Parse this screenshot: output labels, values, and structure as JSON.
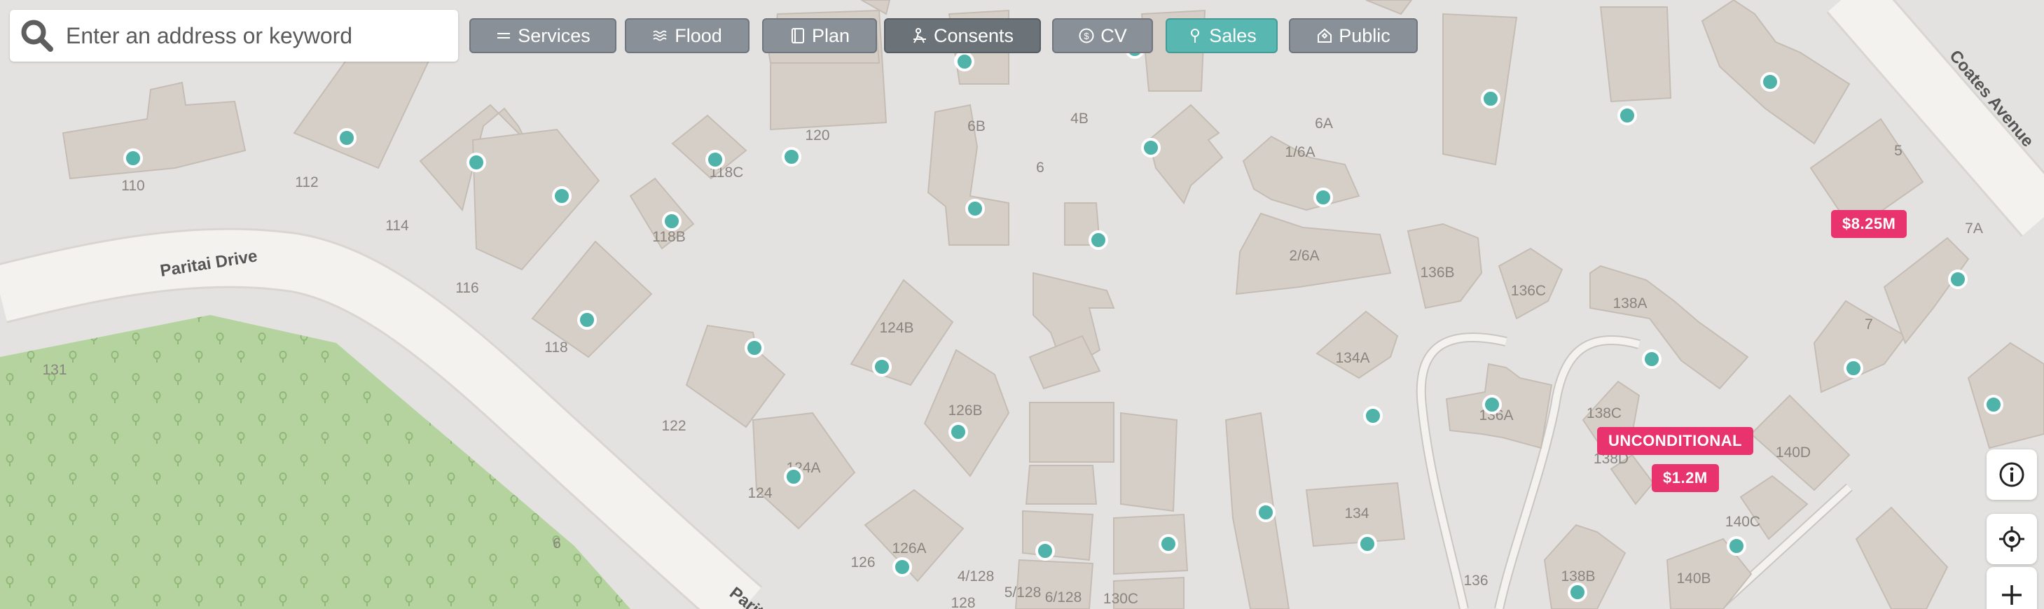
{
  "search": {
    "placeholder": "Enter an address or keyword"
  },
  "layers": [
    {
      "key": "services",
      "label": "Services",
      "icon": "lines-icon",
      "state": "inactive"
    },
    {
      "key": "flood",
      "label": "Flood",
      "icon": "waves-icon",
      "state": "inactive"
    },
    {
      "key": "plan",
      "label": "Plan",
      "icon": "book-icon",
      "state": "inactive"
    },
    {
      "key": "consents",
      "label": "Consents",
      "icon": "worker-icon",
      "state": "active-dark"
    },
    {
      "key": "cv",
      "label": "CV",
      "icon": "coin-icon",
      "state": "inactive"
    },
    {
      "key": "sales",
      "label": "Sales",
      "icon": "pin-icon",
      "state": "active-teal"
    },
    {
      "key": "public",
      "label": "Public",
      "icon": "house-icon",
      "state": "inactive"
    }
  ],
  "streets": [
    "Paritai Drive",
    "Paritai",
    "Coates Avenue"
  ],
  "address_labels": [
    "110",
    "112",
    "114",
    "116",
    "118",
    "120",
    "122",
    "124",
    "124A",
    "126",
    "126A",
    "4/128",
    "5/128",
    "6/128",
    "128",
    "130C",
    "118B",
    "118C",
    "124B",
    "126B",
    "6B",
    "4B",
    "6",
    "6A",
    "1/6A",
    "2/6A",
    "134",
    "134A",
    "136",
    "136A",
    "136B",
    "136C",
    "138A",
    "138B",
    "138C",
    "138D",
    "140B",
    "140C",
    "140D",
    "5",
    "7",
    "7A",
    "131",
    "6"
  ],
  "price_tags": [
    {
      "label": "$8.25M"
    },
    {
      "label": "UNCONDITIONAL"
    },
    {
      "label": "$1.2M"
    }
  ],
  "map_controls": [
    {
      "name": "info",
      "icon": "info-icon"
    },
    {
      "name": "locate",
      "icon": "crosshair-icon"
    },
    {
      "name": "zoom-in",
      "icon": "plus-icon"
    }
  ],
  "colors": {
    "land": "#e3e2e1",
    "building": "#d6cfc8",
    "building_stroke": "#c5bdb4",
    "road": "#f4f2ee",
    "park": "#b5d39e",
    "marker": "#4fb3aa",
    "price_tag": "#e8336f",
    "layer_button": "#8a9097",
    "layer_active_teal": "#58b7b1",
    "layer_active_dark": "#6b7278"
  }
}
